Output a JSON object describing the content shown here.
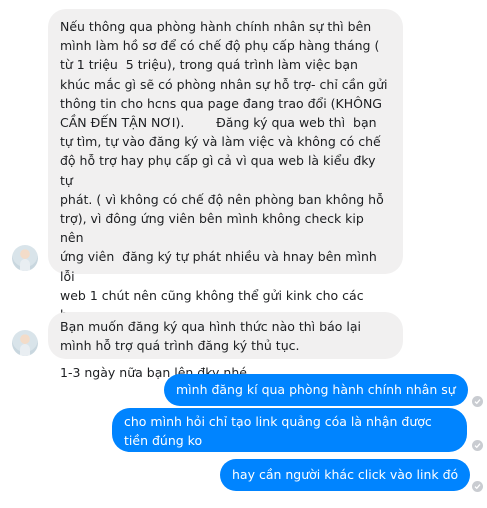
{
  "messages": [
    {
      "direction": "incoming",
      "text": "Nếu thông qua phòng hành chính nhân sự thì bên\nmình làm hồ sơ để có chế độ phụ cấp hàng tháng (\ntừ 1 triệu  5 triệu), trong quá trình làm việc bạn\nkhúc mắc gì sẽ có phòng nhân sự hỗ trợ- chỉ cần gửi\nthông tin cho hcns qua page đang trao đổi (KHÔNG\nCẦN ĐẾN TẬN NƠI).        Đăng ký qua web thì  bạn\ntự tìm, tự vào đăng ký và làm việc và không có chế\nđộ hỗ trợ hay phụ cấp gì cả vì qua web là kiểu đky tự\nphát. ( vì không có chế độ nên phòng ban không hỗ\ntrợ), vì đông ứng viên bên mình không check kip nên\nứng viên  đăng ký tự phát nhiều và hnay bên mình lỗi\nweb 1 chút nên cũng không thể gửi kink cho các bạn\nvì lỗi web nó mất định dạng link, nếu đky qua web thì\n1-3 ngày nữa bạn lên đky nhé."
    },
    {
      "direction": "incoming",
      "text": "Bạn muốn đăng ký qua hình thức nào thì báo lại\nmình hỗ trợ quá trình đăng ký thủ tục."
    },
    {
      "direction": "outgoing",
      "text": "mình đăng kí qua phòng hành chính nhân sự"
    },
    {
      "direction": "outgoing",
      "text": "cho mình hỏi chỉ tạo link quảng cóa là nhận được tiền đúng ko"
    },
    {
      "direction": "outgoing",
      "text": "hay cần người khác click vào link đó"
    }
  ],
  "colors": {
    "incoming_bubble": "#f1f0f0",
    "outgoing_bubble": "#0084ff",
    "outgoing_text": "#ffffff",
    "incoming_text": "#1c1e21"
  },
  "icons": {
    "avatar": "contact-avatar",
    "read_receipt": "sent-check-icon"
  }
}
